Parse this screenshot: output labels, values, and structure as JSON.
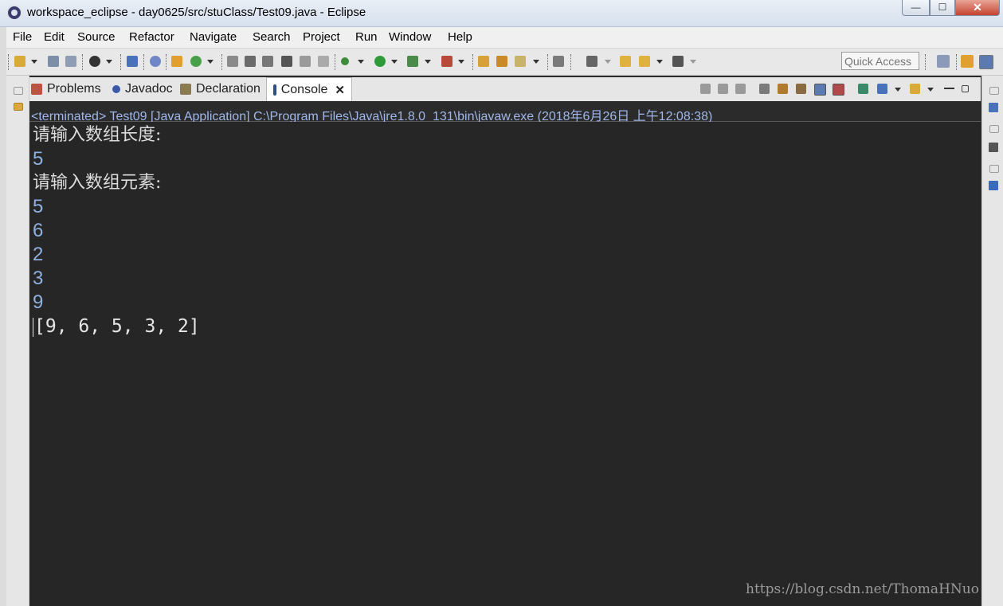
{
  "window": {
    "title": "workspace_eclipse - day0625/src/stuClass/Test09.java - Eclipse",
    "controls": {
      "minimize": "—",
      "maximize": "☐",
      "close": "✕"
    }
  },
  "menu": [
    "File",
    "Edit",
    "Source",
    "Refactor",
    "Navigate",
    "Search",
    "Project",
    "Run",
    "Window",
    "Help"
  ],
  "toolbar": {
    "quick_access_placeholder": "Quick Access",
    "icons": [
      "new-icon",
      "save-icon",
      "save-all-icon",
      "debug-target-icon",
      "terminal-icon",
      "skip-breakpoints-icon",
      "new-java-project-icon",
      "new-class-icon",
      "open-type-icon",
      "search-icon",
      "refactor-icon",
      "debug-icon",
      "run-icon",
      "coverage-icon",
      "external-tools-icon",
      "open-folder-icon",
      "pen-icon",
      "annotation-icon",
      "next-annotation-icon",
      "back-icon",
      "forward-icon",
      "open-perspective-icon",
      "java-perspective-icon"
    ]
  },
  "tabs": [
    {
      "label": "Problems",
      "icon": "problems-icon",
      "active": false
    },
    {
      "label": "Javadoc",
      "icon": "javadoc-icon",
      "active": false
    },
    {
      "label": "Declaration",
      "icon": "declaration-icon",
      "active": false
    },
    {
      "label": "Console",
      "icon": "console-icon",
      "active": true,
      "close": "✕"
    }
  ],
  "console": {
    "status": "<terminated> Test09 [Java Application] C:\\Program Files\\Java\\jre1.8.0_131\\bin\\javaw.exe (2018年6月26日 上午12:08:38)",
    "lines": [
      {
        "text": "请输入数组长度:",
        "kind": "prompt"
      },
      {
        "text": "5",
        "kind": "input"
      },
      {
        "text": "请输入数组元素:",
        "kind": "prompt"
      },
      {
        "text": "5",
        "kind": "input"
      },
      {
        "text": "6",
        "kind": "input"
      },
      {
        "text": "2",
        "kind": "input"
      },
      {
        "text": "3",
        "kind": "input"
      },
      {
        "text": "9",
        "kind": "input"
      },
      {
        "text": "[9, 6, 5, 3, 2]",
        "kind": "output"
      }
    ]
  },
  "watermark": "https://blog.csdn.net/ThomaHNuo",
  "colors": {
    "console_bg": "#262626",
    "input_text": "#8fb0e0",
    "status_text": "#9fb7ea",
    "output_text": "#e6e6e6"
  }
}
